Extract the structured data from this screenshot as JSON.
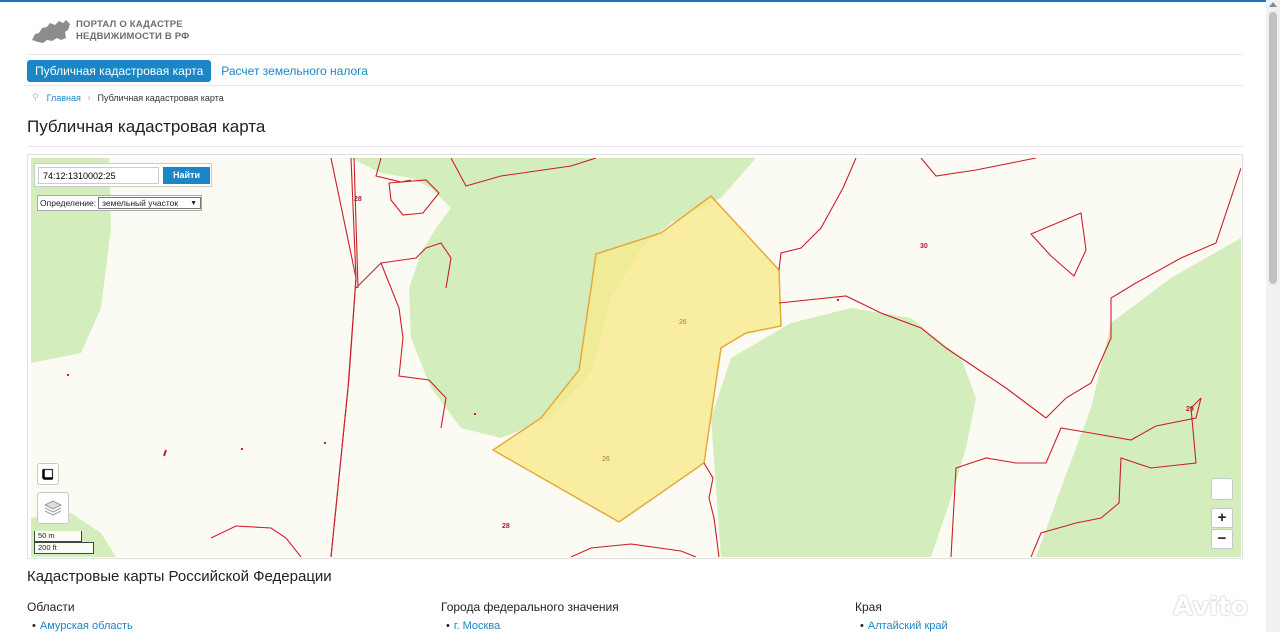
{
  "header": {
    "logo_line1": "ПОРТАЛ О КАДАСТРЕ",
    "logo_line2": "НЕДВИЖИМОСТИ В РФ"
  },
  "nav": {
    "active_tab": "Публичная кадастровая карта",
    "link_tab": "Расчет земельного налога"
  },
  "breadcrumb": {
    "home": "Главная",
    "current": "Публичная кадастровая карта"
  },
  "page_title": "Публичная кадастровая карта",
  "map": {
    "search_value": "74:12:1310002:25",
    "search_button": "Найти",
    "definition_label": "Определение:",
    "definition_value": "земельный участок",
    "labels": {
      "parcel_a": "28",
      "parcel_b": "30",
      "parcel_c": "26",
      "parcel_d": "26",
      "parcel_e": "28",
      "parcel_f": "29"
    },
    "scale_metric": "50 m",
    "scale_imperial": "200 ft",
    "zoom_in": "+",
    "zoom_out": "−",
    "colors": {
      "background": "#fcfbf3",
      "forest": "#d3edbc",
      "boundary": "#cc1f2a",
      "selected_fill": "#f8ea8c",
      "selected_stroke": "#e8a93a"
    }
  },
  "regions": {
    "title": "Кадастровые карты Российской Федерации",
    "columns": [
      {
        "title": "Области",
        "first_item": "Амурская область"
      },
      {
        "title": "Города федерального значения",
        "first_item": "г. Москва"
      },
      {
        "title": "Края",
        "first_item": "Алтайский край"
      }
    ]
  },
  "watermark": "Avito"
}
